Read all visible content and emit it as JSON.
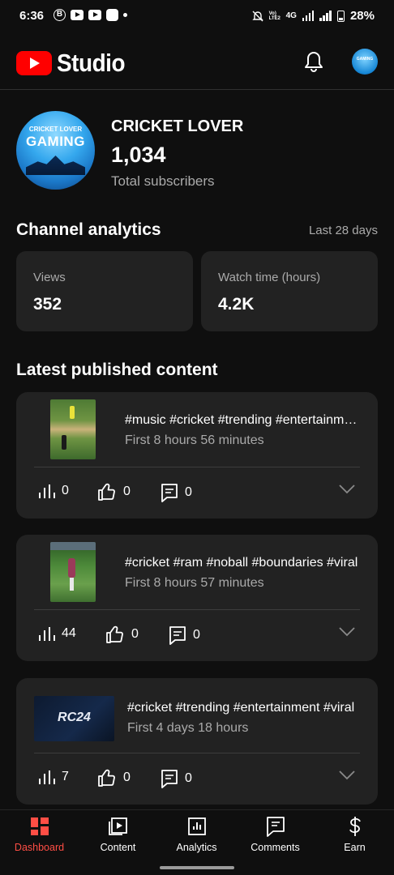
{
  "status_bar": {
    "time": "6:36",
    "notif_badge": "B",
    "network": "4G",
    "volte": "Vo) LTE2",
    "battery": "28%"
  },
  "app_bar": {
    "title": "Studio",
    "bell_icon": "bell-icon",
    "avatar_text": "GAMING"
  },
  "channel": {
    "avatar_line1": "CRICKET LOVER",
    "avatar_line2": "GAMING",
    "name": "CRICKET LOVER",
    "subscribers": "1,034",
    "subscribers_label": "Total subscribers"
  },
  "analytics": {
    "title": "Channel analytics",
    "period": "Last 28 days",
    "cards": [
      {
        "label": "Views",
        "value": "352"
      },
      {
        "label": "Watch time (hours)",
        "value": "4.2K"
      }
    ]
  },
  "latest": {
    "title": "Latest published content",
    "items": [
      {
        "title": "#music #cricket #trending #entertainment",
        "subtitle": "First 8 hours 56 minutes",
        "views": "0",
        "likes": "0",
        "comments": "0"
      },
      {
        "title": "#cricket #ram #noball #boundaries #viral",
        "subtitle": "First 8 hours 57 minutes",
        "views": "44",
        "likes": "0",
        "comments": "0"
      },
      {
        "title": "#cricket #trending #entertainment #viral",
        "subtitle": "First 4 days 18 hours",
        "views": "7",
        "likes": "0",
        "comments": "0",
        "thumb_text": "RC24"
      }
    ]
  },
  "bottom_nav": [
    {
      "label": "Dashboard",
      "icon": "dashboard-icon",
      "active": true
    },
    {
      "label": "Content",
      "icon": "content-icon"
    },
    {
      "label": "Analytics",
      "icon": "analytics-icon"
    },
    {
      "label": "Comments",
      "icon": "comments-icon"
    },
    {
      "label": "Earn",
      "icon": "dollar-icon"
    }
  ],
  "colors": {
    "background": "#0f0f0f",
    "card": "#222222",
    "accent_red": "#ff0000",
    "active_nav": "#ff4e45",
    "muted_text": "#aaaaaa"
  }
}
